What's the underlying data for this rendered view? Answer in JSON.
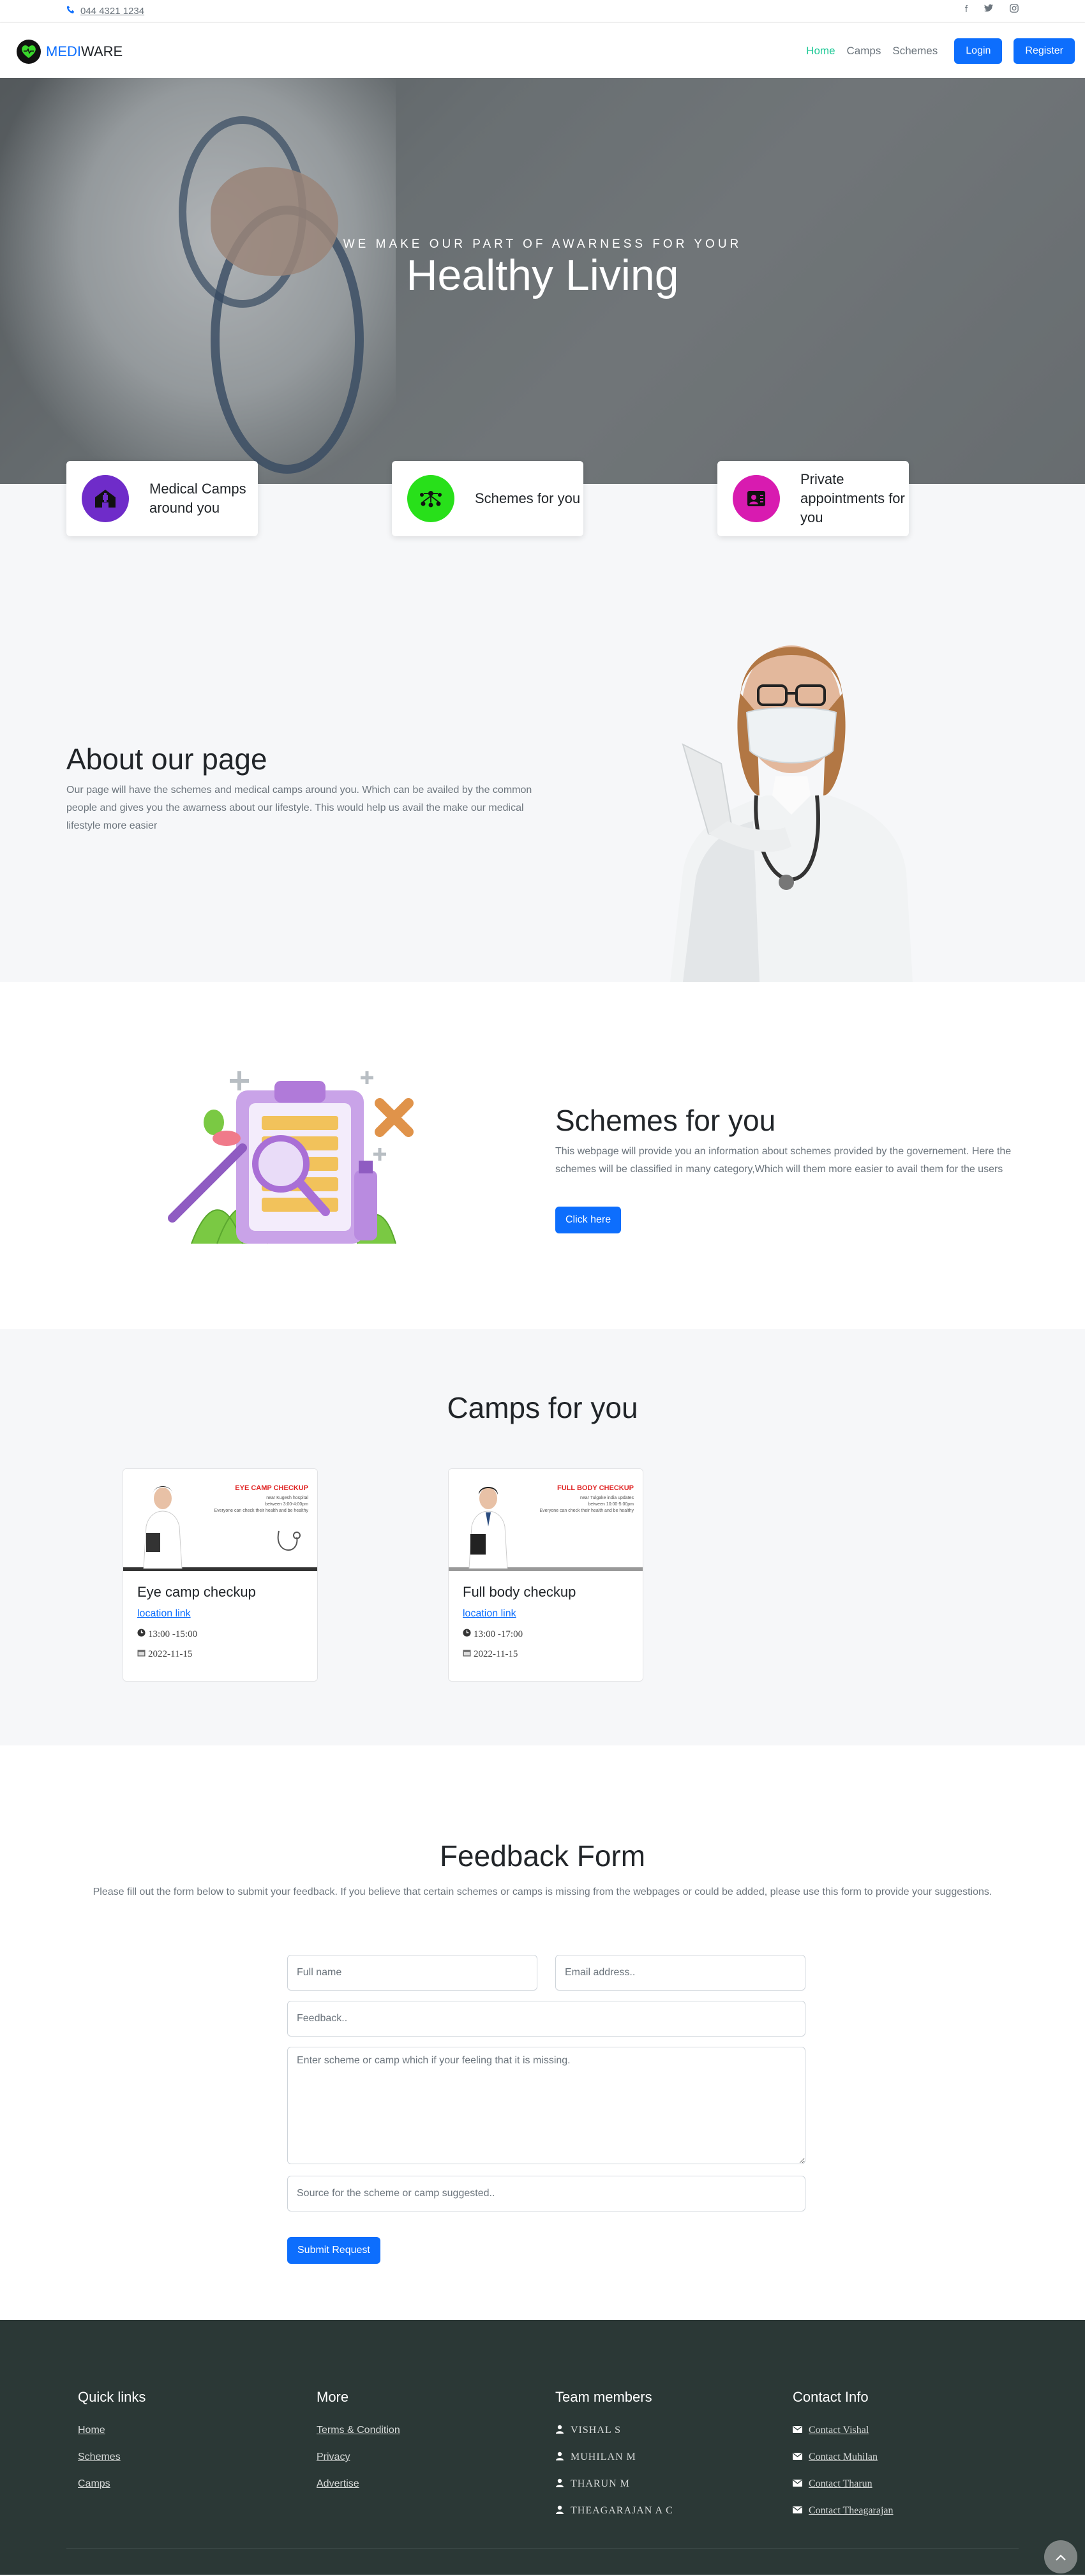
{
  "topbar": {
    "phone": "044 4321 1234",
    "social_icons": [
      "facebook-icon",
      "twitter-icon",
      "instagram-icon"
    ]
  },
  "nav": {
    "brand_part1": "MEDI",
    "brand_part2": "WARE",
    "links": [
      "Home",
      "Camps",
      "Schemes"
    ],
    "login": "Login",
    "register": "Register"
  },
  "hero": {
    "subtitle": "WE MAKE OUR PART OF AWARNESS FOR YOUR",
    "title": "Healthy Living"
  },
  "features": [
    {
      "label": "Medical Camps around you",
      "icon": "hospital-icon",
      "color": "#6f2cc9"
    },
    {
      "label": "Schemes for you",
      "icon": "network-icon",
      "color": "#28e01a"
    },
    {
      "label": "Private appointments for you",
      "icon": "appointment-icon",
      "color": "#d81bb0"
    }
  ],
  "about": {
    "title": "About our page",
    "text": "Our page will have the schemes and medical camps around you. Which can be availed by the common people and gives you the awarness about our lifestyle. This would help us avail the make our medical lifestyle more easier"
  },
  "schemes": {
    "title": "Schemes for you",
    "text": "This webpage will provide you an information about schemes provided by the governement. Here the schemes will be classified in many category,Which will them more easier to avail them for the users",
    "button": "Click here"
  },
  "camps": {
    "title": "Camps for you",
    "items": [
      {
        "poster_title": "EYE CAMP CHECKUP",
        "poster_lines": [
          "near Kugesh hospital",
          "between 3:00-4:00pm",
          "Everyone can check their health and be healthy"
        ],
        "title": "Eye camp checkup",
        "link": "location link",
        "time": "13:00 -15:00",
        "date": "2022-11-15"
      },
      {
        "poster_title": "FULL BODY CHECKUP",
        "poster_lines": [
          "near Tulgake india updates",
          "between 10:00-5:00pm",
          "Everyone can check their health and be healthy"
        ],
        "title": "Full body checkup",
        "link": "location link",
        "time": "13:00 -17:00",
        "date": "2022-11-15"
      }
    ]
  },
  "feedback": {
    "title": "Feedback Form",
    "intro": "Please fill out the form below to submit your feedback. If you believe that certain schemes or camps is missing from the webpages or could be added, please use this form to provide your suggestions.",
    "fullname_placeholder": "Full name",
    "email_placeholder": "Email address..",
    "feedback_placeholder": "Feedback..",
    "missing_placeholder": "Enter scheme or camp which if your feeling that it is missing.",
    "source_placeholder": "Source for the scheme or camp suggested..",
    "submit": "Submit Request"
  },
  "footer": {
    "quick_links": {
      "title": "Quick links",
      "items": [
        "Home",
        "Schemes",
        "Camps"
      ]
    },
    "more": {
      "title": "More",
      "items": [
        "Terms & Condition",
        "Privacy",
        "Advertise"
      ]
    },
    "team": {
      "title": "Team members",
      "items": [
        "VISHAL S",
        "MUHILAN M",
        "THARUN M",
        "THEAGARAJAN A C"
      ]
    },
    "contact": {
      "title": "Contact Info",
      "items": [
        "Contact Vishal",
        "Contact Muhilan",
        "Contact Tharun",
        "Contact Theagarajan"
      ]
    }
  },
  "colors": {
    "primary": "#0d6efd",
    "nav_active": "#20c997",
    "footer_bg": "#2b3836",
    "section_bg": "#f6f7f9"
  }
}
